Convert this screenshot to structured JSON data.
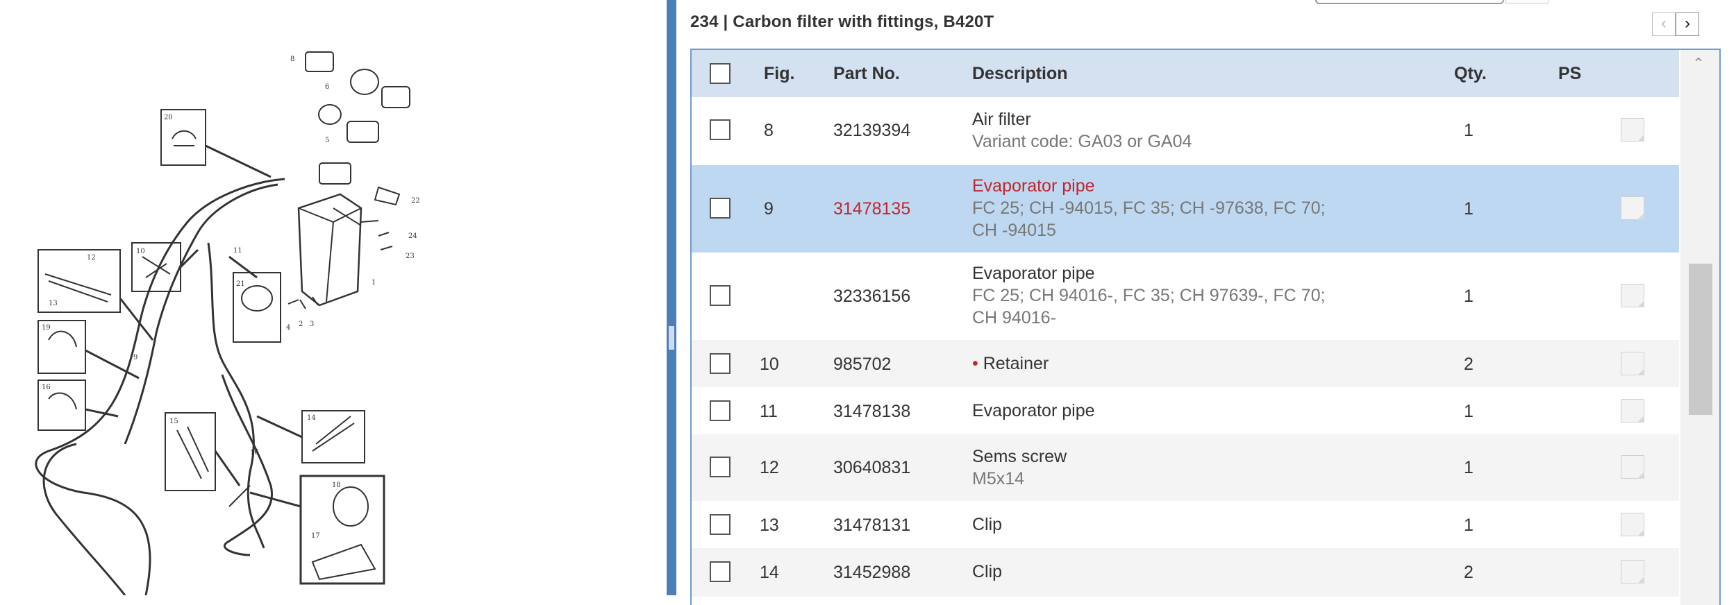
{
  "diagram": {
    "callouts": [
      "8",
      "6",
      "5",
      "20",
      "12",
      "13",
      "10",
      "21",
      "11",
      "19",
      "16",
      "15",
      "14",
      "18",
      "17",
      "22",
      "24",
      "23",
      "2",
      "3",
      "4",
      "1",
      "9"
    ],
    "icons": [
      "exploded-parts-diagram"
    ]
  },
  "panel": {
    "group_title": "234 | Carbon filter with fittings, B420T",
    "prev_label": "‹",
    "next_label": "›",
    "scroll_up_label": "⌃"
  },
  "table": {
    "headers": {
      "fig": "Fig.",
      "part": "Part No.",
      "desc": "Description",
      "qty": "Qty.",
      "ps": "PS"
    },
    "rows": [
      {
        "fig": "8",
        "part": "32139394",
        "desc": "Air filter",
        "sub": [
          "Variant code: GA03 or GA04"
        ],
        "bullet": "",
        "qty": "1",
        "selected": false
      },
      {
        "fig": "9",
        "part": "31478135",
        "desc": "Evaporator pipe",
        "sub": [
          "FC 25; CH -94015, FC 35; CH -97638, FC 70;",
          "CH -94015"
        ],
        "bullet": "",
        "qty": "1",
        "selected": true
      },
      {
        "fig": "",
        "part": "32336156",
        "desc": "Evaporator pipe",
        "sub": [
          "FC 25; CH 94016-, FC 35; CH 97639-, FC 70;",
          "CH 94016-"
        ],
        "bullet": "",
        "qty": "1",
        "selected": false
      },
      {
        "fig": "10",
        "part": "985702",
        "desc": "Retainer",
        "sub": [],
        "bullet": "•",
        "qty": "2",
        "selected": false
      },
      {
        "fig": "11",
        "part": "31478138",
        "desc": "Evaporator pipe",
        "sub": [],
        "bullet": "",
        "qty": "1",
        "selected": false
      },
      {
        "fig": "12",
        "part": "30640831",
        "desc": "Sems screw",
        "sub": [
          "M5x14"
        ],
        "bullet": "",
        "qty": "1",
        "selected": false
      },
      {
        "fig": "13",
        "part": "31478131",
        "desc": "Clip",
        "sub": [],
        "bullet": "",
        "qty": "1",
        "selected": false
      },
      {
        "fig": "14",
        "part": "31452988",
        "desc": "Clip",
        "sub": [],
        "bullet": "",
        "qty": "2",
        "selected": false
      }
    ]
  },
  "colors": {
    "accent": "#4a7fb8",
    "header_bg": "#d3e1f1",
    "selected_row": "#bfd8f2",
    "selected_text": "#c0262d"
  }
}
